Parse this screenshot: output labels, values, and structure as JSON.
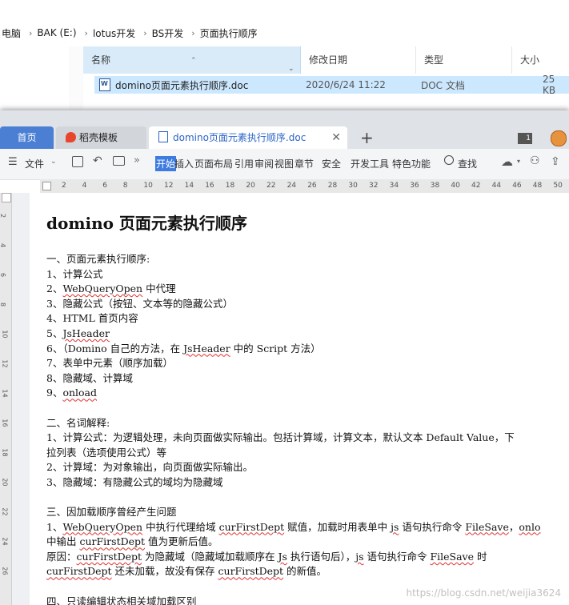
{
  "explorer": {
    "breadcrumb": [
      "电脑",
      "BAK (E:)",
      "lotus开发",
      "BS开发",
      "页面执行顺序"
    ],
    "columns": {
      "name": "名称",
      "date": "修改日期",
      "type": "类型",
      "size": "大小"
    },
    "file": {
      "name": "domino页面元素执行顺序.doc",
      "date": "2020/6/24 11:22",
      "type": "DOC 文档",
      "size": "25 KB"
    }
  },
  "wps": {
    "tabs": {
      "home": "首页",
      "template": "稻壳模板",
      "document": "domino页面元素执行顺序.doc",
      "add": "+"
    },
    "window_count": "1",
    "toolbar": {
      "file": "文件",
      "start": "开始",
      "insert": "插入",
      "layout": "页面布局",
      "reference": "引用",
      "review": "审阅",
      "view": "视图",
      "section": "章节",
      "security": "安全",
      "developer": "开发工具",
      "special": "特色功能",
      "search": "查找"
    },
    "ruler_numbers": [
      "2",
      "4",
      "6",
      "8",
      "10",
      "12",
      "14",
      "16",
      "18",
      "20",
      "22",
      "24",
      "26",
      "28",
      "30",
      "32",
      "34",
      "36",
      "38",
      "40",
      "42",
      "44",
      "46",
      "48",
      "50"
    ],
    "vruler_numbers": [
      "2",
      "4",
      "6",
      "8",
      "10",
      "12",
      "14",
      "16",
      "18",
      "20",
      "22",
      "24",
      "26"
    ],
    "accent_color": "#3d7be0"
  },
  "document": {
    "title": "domino 页面元素执行顺序",
    "lines": [
      "一、页面元素执行顺序:",
      "1、计算公式",
      "2、WebQueryOpen 中代理",
      "3、隐藏公式（按钮、文本等的隐藏公式）",
      "4、HTML 首页内容",
      "5、JsHeader",
      "6、（Domino 自己的方法，在 JsHeader 中的 Script 方法）",
      "7、表单中元素（顺序加载）",
      "8、隐藏域、计算域",
      "9、onload",
      "",
      "二、名词解释:",
      "1、计算公式：为逻辑处理，未向页面做实际输出。包括计算域，计算文本，默认文本 Default Value，下",
      "拉列表（选项使用公式）等",
      "2、计算域：为对象输出，向页面做实际输出。",
      "3、隐藏域：有隐藏公式的域均为隐藏域",
      "",
      "三、因加载顺序曾经产生问题",
      "1、WebQueryOpen 中执行代理给域 curFirstDept 赋值，加载时用表单中 js 语句执行命令 FileSave，onlo",
      "中输出 curFirstDept 值为更新后值。",
      "原因：curFirstDept 为隐藏域（隐藏域加载顺序在 Js 执行语句后），js 语句执行命令 FileSave 时",
      "curFirstDept 还未加载，故没有保存 curFirstDept 的新值。",
      "",
      "四、只读编辑状态相关域加载区别"
    ]
  },
  "watermark": "https://blog.csdn.net/weijia3624"
}
